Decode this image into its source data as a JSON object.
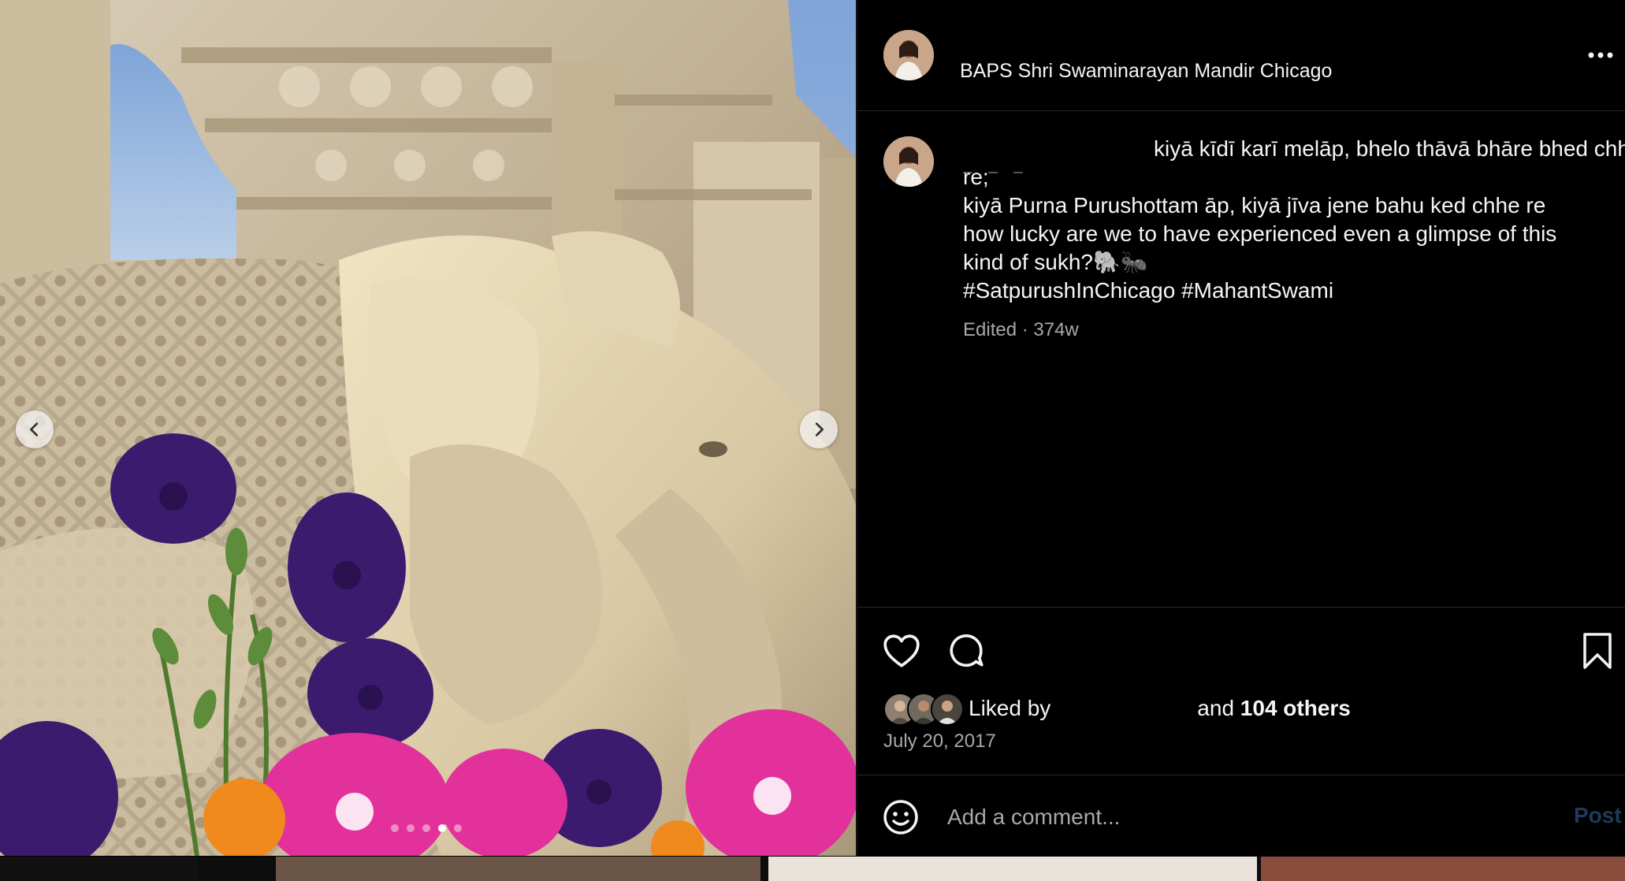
{
  "post": {
    "location": "BAPS Shri Swaminarayan Mandir Chicago",
    "caption_lines": [
      "kiyā kīdī karī melāp, bhelo thāvā bhāre bhed chhe",
      "re;",
      "kiyā Purna Purushottam āp, kiyā jīva jene bahu ked chhe re",
      "how lucky are we to have experienced even a glimpse of this",
      "kind of sukh?🐘🐜",
      "#SatpurushInChicago #MahantSwami"
    ],
    "meta": "Edited · 374w",
    "liked_by_label": "Liked by",
    "liked_by_and": "and",
    "liked_by_others": "104 others",
    "date": "July 20, 2017"
  },
  "comment_box": {
    "placeholder": "Add a comment...",
    "post_label": "Post"
  },
  "carousel": {
    "slide_count": 5,
    "active_index": 3
  },
  "icons": {
    "more": "more-options-icon",
    "like": "heart-icon",
    "comment": "comment-icon",
    "save": "bookmark-icon",
    "emoji": "emoji-icon",
    "prev": "chevron-left-icon",
    "next": "chevron-right-icon"
  },
  "colors": {
    "background": "#000000",
    "text": "#f5f5f5",
    "secondary_text": "#a8a8a8",
    "divider": "#262626",
    "post_button": "#1f3a5c"
  }
}
